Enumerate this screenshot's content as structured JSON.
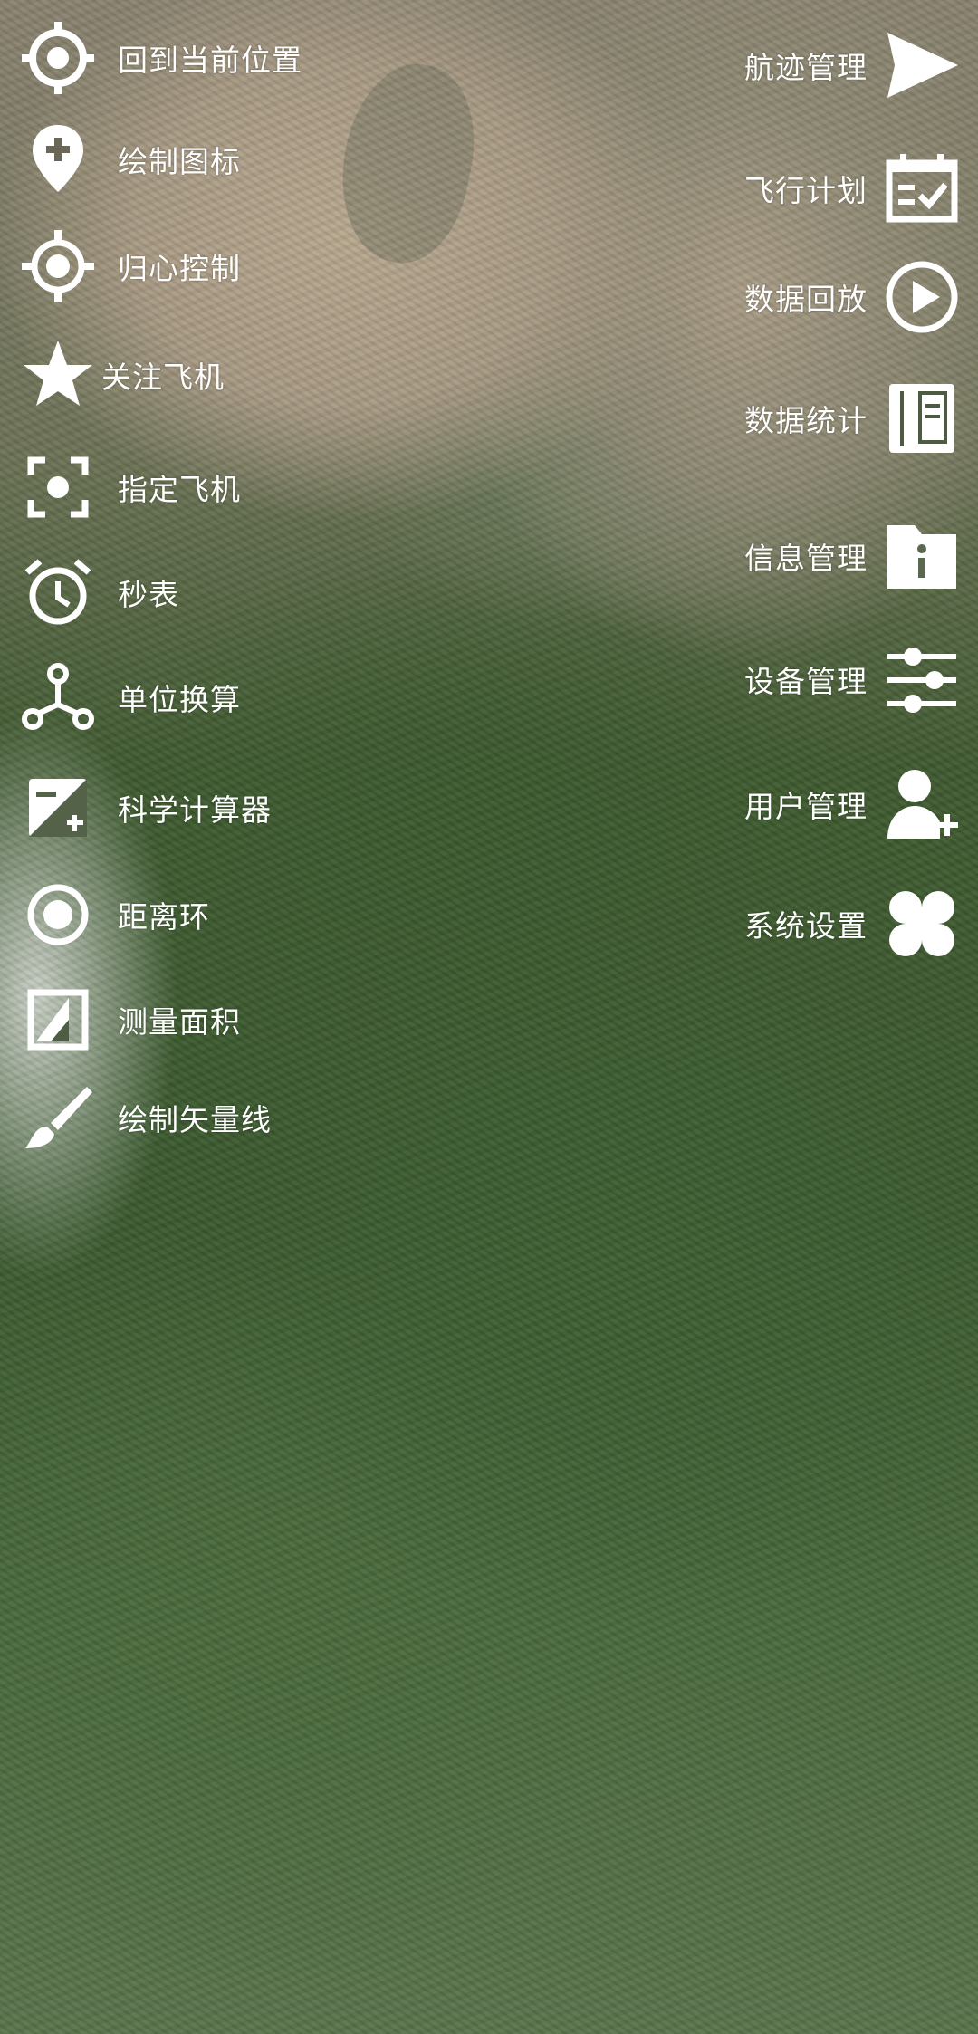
{
  "left_menu": [
    {
      "label": "回到当前位置",
      "icon": "locate-icon"
    },
    {
      "label": "绘制图标",
      "icon": "map-pin-icon"
    },
    {
      "label": "归心控制",
      "icon": "crosshair-icon"
    },
    {
      "label": "关注飞机",
      "icon": "star-icon"
    },
    {
      "label": "指定飞机",
      "icon": "target-frame-icon"
    },
    {
      "label": "秒表",
      "icon": "alarm-clock-icon"
    },
    {
      "label": "单位换算",
      "icon": "network-icon"
    },
    {
      "label": "科学计算器",
      "icon": "calculator-icon"
    },
    {
      "label": "距离环",
      "icon": "radio-button-icon"
    },
    {
      "label": "测量面积",
      "icon": "area-icon"
    },
    {
      "label": "绘制矢量线",
      "icon": "brush-icon"
    }
  ],
  "right_menu": [
    {
      "label": "航迹管理",
      "icon": "send-icon"
    },
    {
      "label": "飞行计划",
      "icon": "calendar-check-icon"
    },
    {
      "label": "数据回放",
      "icon": "play-circle-icon"
    },
    {
      "label": "数据统计",
      "icon": "book-icon"
    },
    {
      "label": "信息管理",
      "icon": "info-folder-icon"
    },
    {
      "label": "设备管理",
      "icon": "sliders-icon"
    },
    {
      "label": "用户管理",
      "icon": "add-user-icon"
    },
    {
      "label": "系统设置",
      "icon": "clover-icon"
    }
  ],
  "colors": {
    "foreground": "#ffffff"
  }
}
